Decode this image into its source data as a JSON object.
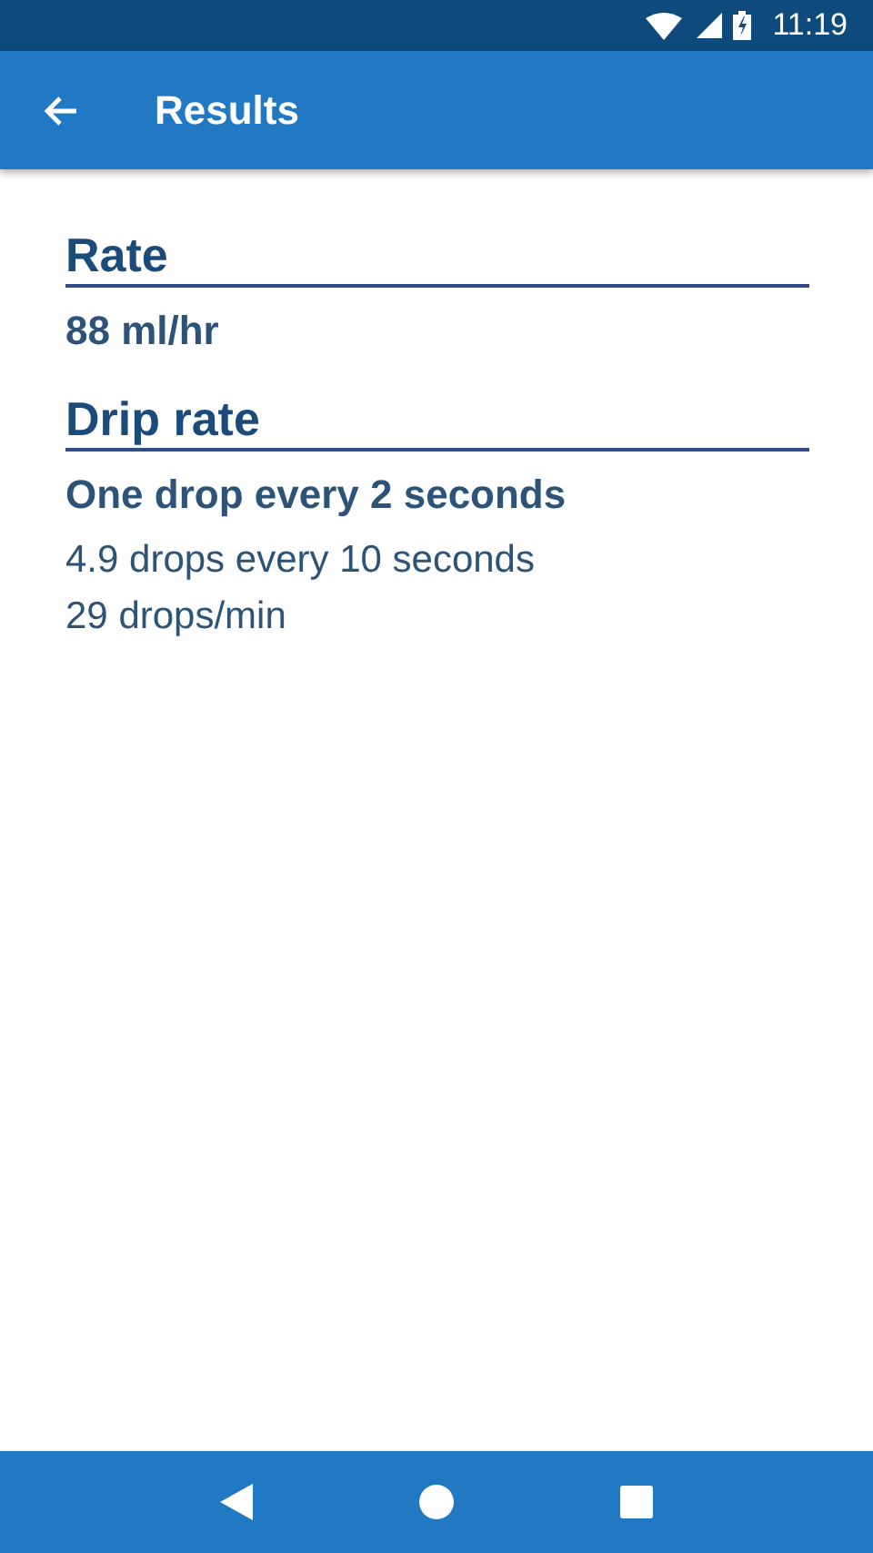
{
  "status_bar": {
    "time": "11:19"
  },
  "app_bar": {
    "title": "Results"
  },
  "sections": [
    {
      "heading": "Rate",
      "lines": [
        {
          "kind": "primary",
          "text": "88 ml/hr"
        }
      ]
    },
    {
      "heading": "Drip rate",
      "lines": [
        {
          "kind": "primary",
          "text": "One drop every 2 seconds"
        },
        {
          "kind": "secondary",
          "text": "4.9 drops every 10 seconds"
        },
        {
          "kind": "secondary",
          "text": "29 drops/min"
        }
      ]
    }
  ]
}
